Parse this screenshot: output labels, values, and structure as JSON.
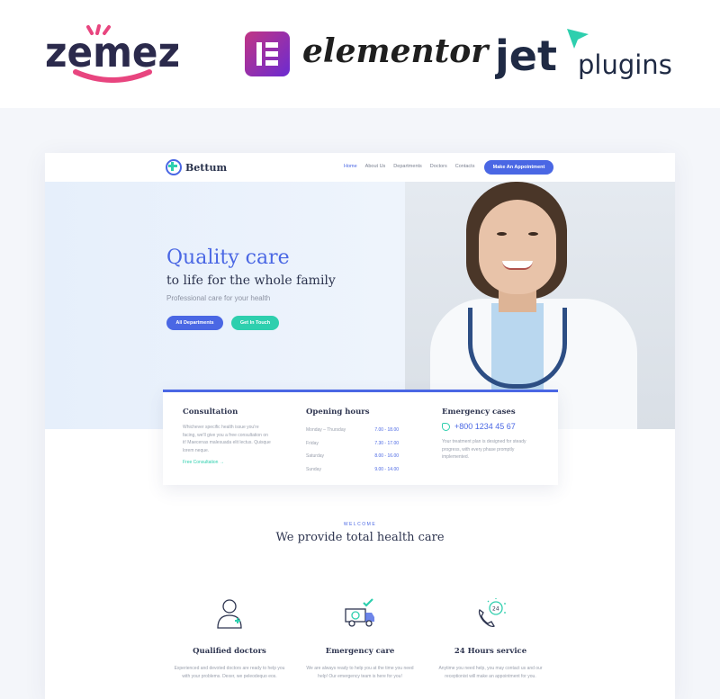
{
  "brands": {
    "zemez": "zemez",
    "elementor": "elementor",
    "jet_main": "jet",
    "jet_sub": "plugins",
    "zemez_colors": {
      "text": "#2b2a4c",
      "accent": "#6d4cf0",
      "smile": "#e8457f"
    },
    "jet_accent": "#2ecfae"
  },
  "site": {
    "logo_text": "Bettum",
    "menu": [
      "Home",
      "About Us",
      "Departments",
      "Doctors",
      "Contacts"
    ],
    "cta": "Make An Appointment",
    "colors": {
      "primary": "#4a67e4",
      "secondary": "#2ecfae",
      "text": "#2e3550"
    }
  },
  "hero": {
    "title": "Quality care",
    "subtitle": "to life for the whole family",
    "tagline": "Professional care for your health",
    "btn_primary": "All Departments",
    "btn_secondary": "Get In Touch"
  },
  "cards": {
    "consultation": {
      "title": "Consultation",
      "text": "Whichever specific health issue you're facing, we'll give you a free consultation on it! Maecenas malesuada elit lectus. Quisque lorem neque.",
      "link": "Free Consultation"
    },
    "hours": {
      "title": "Opening hours",
      "rows": [
        {
          "day": "Monday – Thursday",
          "time": "7.00 - 18.00"
        },
        {
          "day": "Friday",
          "time": "7.30 - 17.00"
        },
        {
          "day": "Saturday",
          "time": "8.00 - 16.00"
        },
        {
          "day": "Sunday",
          "time": "9.00 - 14.00"
        }
      ]
    },
    "emergency": {
      "title": "Emergency cases",
      "phone": "+800 1234 45 67",
      "text": "Your treatment plan is designed for steady progress, with every phase promptly implemented."
    }
  },
  "welcome": {
    "kicker": "WELCOME",
    "heading": "We provide total health care"
  },
  "features": [
    {
      "icon": "doctor-icon",
      "title": "Qualified doctors",
      "text": "Experienced and devoted doctors are ready to help you with your problems. Dexer, we peleodequo eos."
    },
    {
      "icon": "ambulance-icon",
      "title": "Emergency care",
      "text": "We are always ready to help you at the time you need help! Our emergency team is here for you!"
    },
    {
      "icon": "24h-phone-icon",
      "title": "24 Hours service",
      "text": "Anytime you need help, you may contact us and our receptionist will make an appointment for you."
    }
  ]
}
